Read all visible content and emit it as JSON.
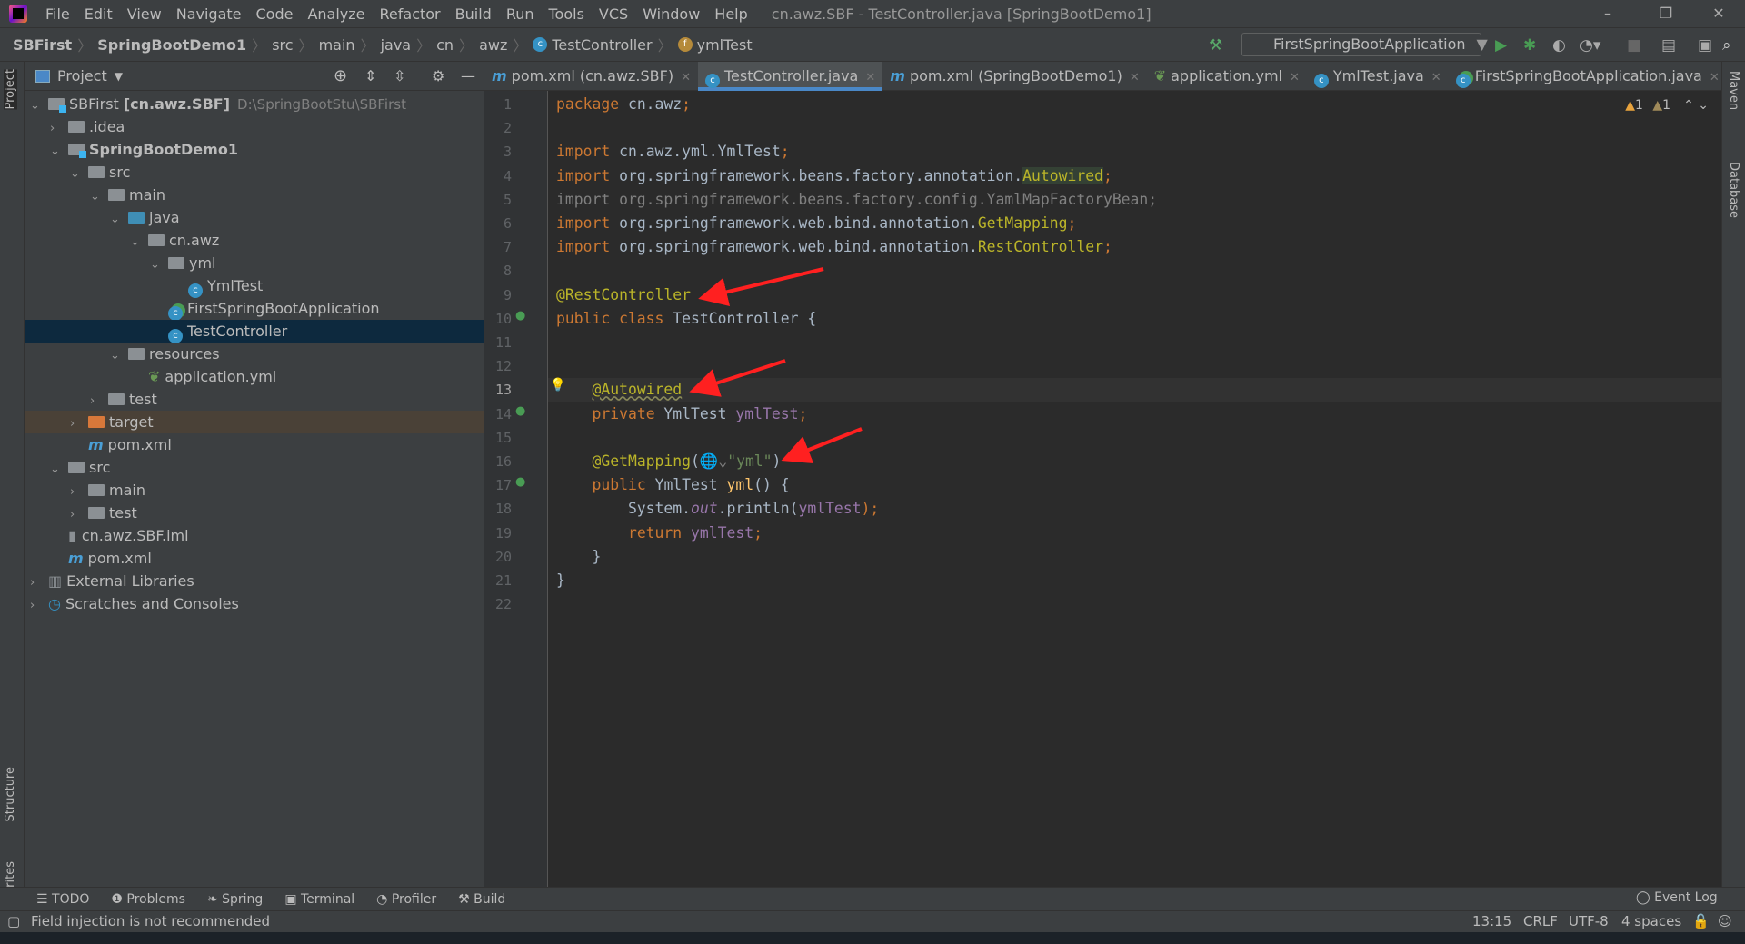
{
  "window": {
    "title": "cn.awz.SBF - TestController.java [SpringBootDemo1]"
  },
  "menu": [
    "File",
    "Edit",
    "View",
    "Navigate",
    "Code",
    "Analyze",
    "Refactor",
    "Build",
    "Run",
    "Tools",
    "VCS",
    "Window",
    "Help"
  ],
  "breadcrumb": [
    "SBFirst",
    "SpringBootDemo1",
    "src",
    "main",
    "java",
    "cn",
    "awz",
    "TestController",
    "ymlTest"
  ],
  "toolbar": {
    "run_config": "FirstSpringBootApplication"
  },
  "project": {
    "title": "Project",
    "tree": [
      {
        "level": 0,
        "arrow": "v",
        "icon": "module",
        "label": "SBFirst",
        "bold_suffix": "[cn.awz.SBF]",
        "path": "D:\\SpringBootStu\\SBFirst"
      },
      {
        "level": 1,
        "arrow": ">",
        "icon": "folder",
        "label": ".idea"
      },
      {
        "level": 1,
        "arrow": "v",
        "icon": "module",
        "label": "SpringBootDemo1",
        "bold": true
      },
      {
        "level": 2,
        "arrow": "v",
        "icon": "folder",
        "label": "src"
      },
      {
        "level": 3,
        "arrow": "v",
        "icon": "folder",
        "label": "main"
      },
      {
        "level": 4,
        "arrow": "v",
        "icon": "src",
        "label": "java"
      },
      {
        "level": 5,
        "arrow": "v",
        "icon": "package",
        "label": "cn.awz"
      },
      {
        "level": 6,
        "arrow": "v",
        "icon": "package",
        "label": "yml"
      },
      {
        "level": 7,
        "arrow": "",
        "icon": "class",
        "label": "YmlTest"
      },
      {
        "level": 6,
        "arrow": "",
        "icon": "springclass",
        "label": "FirstSpringBootApplication"
      },
      {
        "level": 6,
        "arrow": "",
        "icon": "class",
        "label": "TestController",
        "selected": true
      },
      {
        "level": 4,
        "arrow": "v",
        "icon": "folder",
        "label": "resources"
      },
      {
        "level": 5,
        "arrow": "",
        "icon": "yml",
        "label": "application.yml"
      },
      {
        "level": 3,
        "arrow": ">",
        "icon": "folder",
        "label": "test"
      },
      {
        "level": 2,
        "arrow": ">",
        "icon": "target",
        "label": "target",
        "highlight": true
      },
      {
        "level": 2,
        "arrow": "",
        "icon": "maven",
        "label": "pom.xml"
      },
      {
        "level": 1,
        "arrow": "v",
        "icon": "folder",
        "label": "src"
      },
      {
        "level": 2,
        "arrow": ">",
        "icon": "folder",
        "label": "main"
      },
      {
        "level": 2,
        "arrow": ">",
        "icon": "folder",
        "label": "test"
      },
      {
        "level": 1,
        "arrow": "",
        "icon": "iml",
        "label": "cn.awz.SBF.iml"
      },
      {
        "level": 1,
        "arrow": "",
        "icon": "maven",
        "label": "pom.xml"
      },
      {
        "level": 0,
        "arrow": ">",
        "icon": "library",
        "label": "External Libraries"
      },
      {
        "level": 0,
        "arrow": ">",
        "icon": "scratch",
        "label": "Scratches and Consoles"
      }
    ]
  },
  "tabs": [
    {
      "icon": "maven",
      "label": "pom.xml (cn.awz.SBF)"
    },
    {
      "icon": "class",
      "label": "TestController.java",
      "active": true
    },
    {
      "icon": "maven",
      "label": "pom.xml (SpringBootDemo1)"
    },
    {
      "icon": "yml",
      "label": "application.yml"
    },
    {
      "icon": "class",
      "label": "YmlTest.java"
    },
    {
      "icon": "springclass",
      "label": "FirstSpringBootApplication.java"
    }
  ],
  "editor": {
    "warnings": "1",
    "weak_warnings": "1",
    "current_line": 13,
    "lines": [
      [
        [
          "package",
          "kw"
        ],
        [
          " cn.awz",
          ""
        ],
        [
          ";",
          "kw"
        ]
      ],
      [],
      [
        [
          "import",
          "kw"
        ],
        [
          " cn.awz.yml.YmlTest",
          ""
        ],
        [
          ";",
          "kw"
        ]
      ],
      [
        [
          "import",
          "kw"
        ],
        [
          " org.springframework.beans.factory.annotation.",
          ""
        ],
        [
          "Autowired",
          "an hl"
        ],
        [
          ";",
          "kw"
        ]
      ],
      [
        [
          "import org.springframework.beans.factory.config.YamlMapFactoryBean;",
          "unused"
        ]
      ],
      [
        [
          "import",
          "kw"
        ],
        [
          " org.springframework.web.bind.annotation.",
          ""
        ],
        [
          "GetMapping",
          "an"
        ],
        [
          ";",
          "kw"
        ]
      ],
      [
        [
          "import",
          "kw"
        ],
        [
          " org.springframework.web.bind.annotation.",
          ""
        ],
        [
          "RestController",
          "an"
        ],
        [
          ";",
          "kw"
        ]
      ],
      [],
      [
        [
          "@RestController",
          "an"
        ]
      ],
      [
        [
          "public class",
          "kw"
        ],
        [
          " TestController {",
          ""
        ]
      ],
      [],
      [],
      [
        [
          "    ",
          ""
        ],
        [
          "@Autowired",
          "an wavy"
        ]
      ],
      [
        [
          "    ",
          ""
        ],
        [
          "private",
          "kw"
        ],
        [
          " YmlTest ",
          ""
        ],
        [
          "ymlTest",
          "fld"
        ],
        [
          ";",
          "kw"
        ]
      ],
      [],
      [
        [
          "    ",
          ""
        ],
        [
          "@GetMapping",
          "an"
        ],
        [
          "(",
          ""
        ],
        [
          "🌐⌄",
          "unused"
        ],
        [
          "\"yml\"",
          "str"
        ],
        [
          ")",
          ""
        ]
      ],
      [
        [
          "    ",
          ""
        ],
        [
          "public",
          "kw"
        ],
        [
          " YmlTest ",
          ""
        ],
        [
          "yml",
          "fn"
        ],
        [
          "() {",
          ""
        ]
      ],
      [
        [
          "        System.",
          ""
        ],
        [
          "out",
          "st"
        ],
        [
          ".println(",
          ""
        ],
        [
          "ymlTest",
          "fld"
        ],
        [
          ");",
          "kw"
        ]
      ],
      [
        [
          "        ",
          ""
        ],
        [
          "return",
          "kw"
        ],
        [
          " ",
          ""
        ],
        [
          "ymlTest",
          "fld"
        ],
        [
          ";",
          "kw"
        ]
      ],
      [
        [
          "    }",
          ""
        ]
      ],
      [
        [
          "}",
          ""
        ]
      ],
      []
    ]
  },
  "right_strip": [
    "Maven",
    "Database"
  ],
  "left_strip": [
    "Project",
    "Structure",
    "Favorites"
  ],
  "tool_windows": [
    "TODO",
    "Problems",
    "Spring",
    "Terminal",
    "Profiler",
    "Build"
  ],
  "event_log": "Event Log",
  "status": {
    "message": "Field injection is not recommended",
    "position": "13:15",
    "line_sep": "CRLF",
    "encoding": "UTF-8",
    "indent": "4 spaces"
  },
  "colors": {
    "accent": "#4a88c7",
    "arrow": "#ff2020",
    "selection": "#0d293e"
  }
}
